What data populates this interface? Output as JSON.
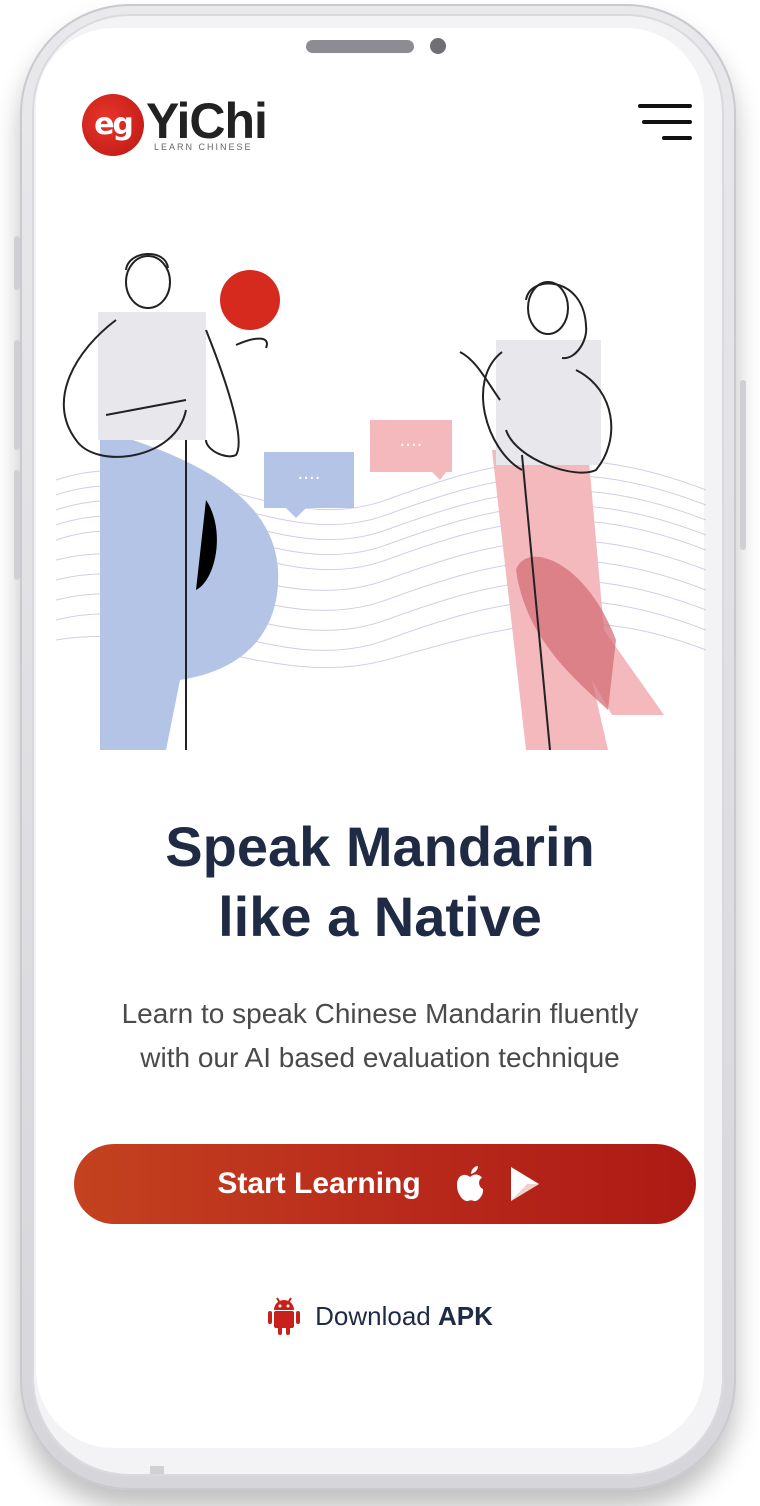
{
  "header": {
    "logo_mark": "eg",
    "logo_text": "YiChi",
    "logo_sub": "LEARN CHINESE",
    "menu_icon": "hamburger-menu-icon"
  },
  "hero": {
    "speech_bubble_left": "····",
    "speech_bubble_right": "····",
    "headline_line1": "Speak Mandarin",
    "headline_line2": "like a Native",
    "subtext_line1": "Learn to speak Chinese Mandarin fluently",
    "subtext_line2": "with our AI based evaluation technique"
  },
  "cta": {
    "label": "Start Learning",
    "icons": [
      "apple-icon",
      "google-play-icon"
    ]
  },
  "apk": {
    "icon": "android-icon",
    "label_regular": "Download",
    "label_bold": "APK"
  },
  "colors": {
    "brand_red": "#c8201a",
    "cta_start": "#c4421f",
    "cta_end": "#ad1a14",
    "headline": "#1f2b45",
    "illustration_blue": "#b3c4e6",
    "illustration_pink": "#f4b9bd"
  }
}
